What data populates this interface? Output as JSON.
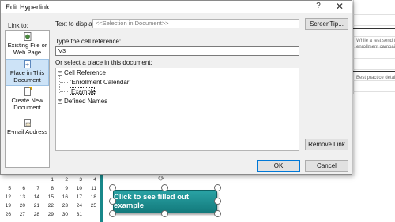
{
  "background": {
    "notes": [
      "While a test send t",
      "enrollment campaig",
      "Best practice detail"
    ],
    "calendar": [
      [
        "",
        "",
        "",
        "",
        "1",
        "2",
        "3",
        "4"
      ],
      [
        "5",
        "6",
        "7",
        "8",
        "9",
        "10",
        "11"
      ],
      [
        "12",
        "13",
        "14",
        "15",
        "16",
        "17",
        "18"
      ],
      [
        "19",
        "20",
        "21",
        "22",
        "23",
        "24",
        "25"
      ],
      [
        "26",
        "27",
        "28",
        "29",
        "30",
        "31"
      ]
    ],
    "shape_button_label": "Click to see filled out example",
    "colors": {
      "teal": "#18888a"
    }
  },
  "dialog": {
    "title": "Edit Hyperlink",
    "help": "?",
    "close": "✕",
    "link_to_label": "Link to:",
    "link_types": [
      {
        "label": "Existing File or Web Page",
        "icon": "globe-document-icon"
      },
      {
        "label": "Place in This Document",
        "icon": "document-arrow-icon"
      },
      {
        "label": "Create New Document",
        "icon": "new-document-icon"
      },
      {
        "label": "E-mail Address",
        "icon": "email-icon"
      }
    ],
    "text_to_display_label": "Text to display:",
    "text_to_display_value": "<<Selection in Document>>",
    "screentip_label": "ScreenTip...",
    "cell_ref_label": "Type the cell reference:",
    "cell_ref_value": "V3",
    "place_label": "Or select a place in this document:",
    "tree": {
      "cell_reference": "Cell Reference",
      "items": [
        "'Enrollment Calendar'",
        "Example"
      ],
      "defined_names": "Defined Names"
    },
    "remove_link_label": "Remove Link",
    "ok_label": "OK",
    "cancel_label": "Cancel",
    "colors": {
      "selection": "#cde3f7",
      "primary_border": "#0078d7"
    }
  }
}
